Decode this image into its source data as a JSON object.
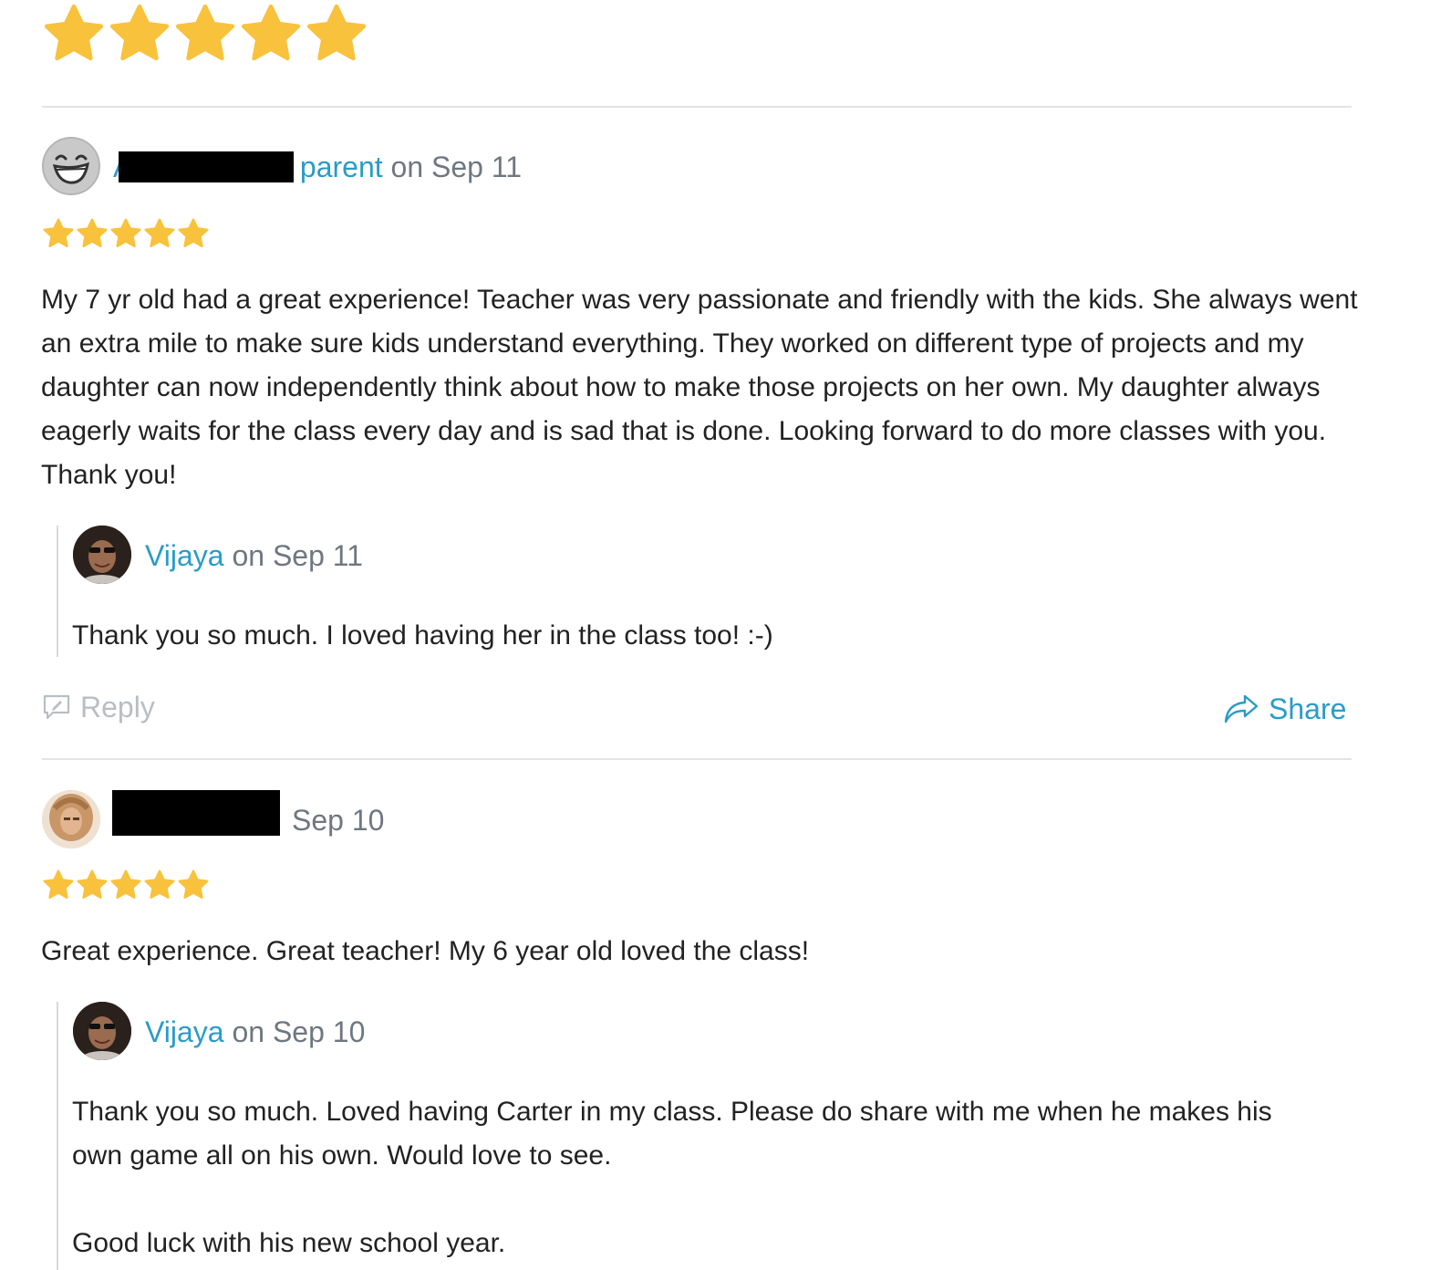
{
  "top_rating": {
    "stars": 5,
    "max": 5
  },
  "colors": {
    "star": "#f9c23c",
    "link": "#2a9cc8",
    "muted": "#6f7780",
    "divider": "#e3e3e3"
  },
  "reviews": [
    {
      "author_visible_prefix": "A",
      "author_role": "parent",
      "date_text": "on Sep 11",
      "avatar_icon": "grinning-face-icon",
      "rating": 5,
      "text": "My 7 yr old had a great experience!  Teacher was very passionate and friendly with the kids. She always went an extra mile to make sure kids understand everything. They worked on different type of projects and my daughter can now independently think about how to make those projects on her own. My daughter always eagerly waits for the class every day and is sad that is done. Looking forward to do more classes with you. Thank you!",
      "reply": {
        "author": "Vijaya",
        "date_text": "on Sep 11",
        "text": "Thank you so much. I loved having her in the class too!  :-)"
      },
      "actions": {
        "reply_label": "Reply",
        "share_label": "Share"
      }
    },
    {
      "date_text": "Sep 10",
      "rating": 5,
      "text": "Great experience. Great teacher!  My 6 year old loved the class!",
      "reply": {
        "author": "Vijaya",
        "date_text": "on Sep 10",
        "text_1": "Thank you so much. Loved having Carter in my class. Please do share with me when he makes his own game all on his own. Would love to see.",
        "text_2": "Good luck with his new school year."
      }
    }
  ]
}
